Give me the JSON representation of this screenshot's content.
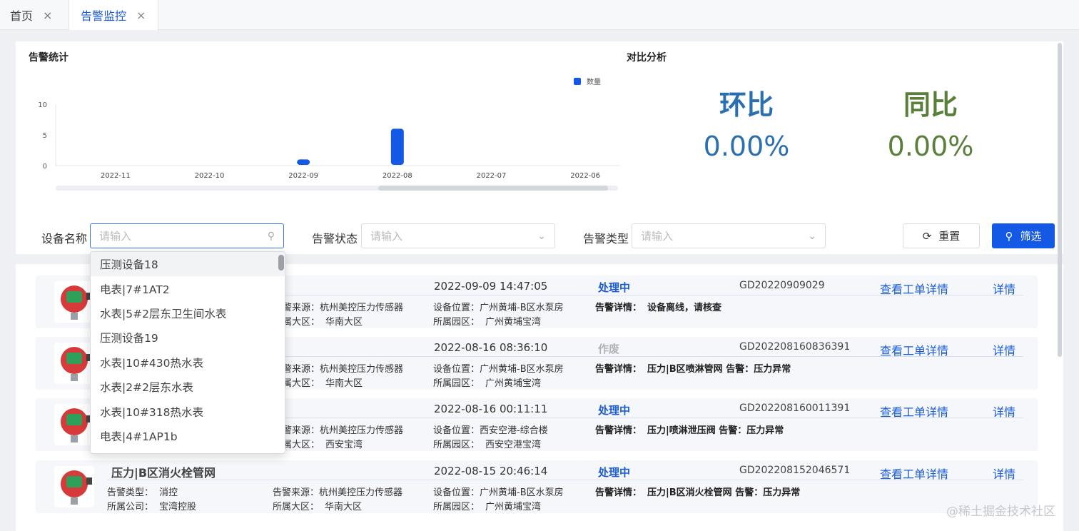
{
  "tabs": [
    {
      "label": "首页",
      "close": "×"
    },
    {
      "label": "告警监控",
      "close": "×"
    }
  ],
  "stats": {
    "title": "告警统计",
    "legend": "数量"
  },
  "chart_data": {
    "type": "bar",
    "categories": [
      "2022-11",
      "2022-10",
      "2022-09",
      "2022-08",
      "2022-07",
      "2022-06"
    ],
    "series": [
      {
        "name": "数量",
        "values": [
          0,
          0,
          1,
          6,
          0,
          0
        ]
      }
    ],
    "yticks": [
      0,
      5,
      10
    ],
    "ylim": [
      0,
      10
    ],
    "bar_color": "#1458e6",
    "grid": false
  },
  "compare": {
    "title": "对比分析",
    "mom_label": "环比",
    "mom_value": "0.00%",
    "yoy_label": "同比",
    "yoy_value": "0.00%",
    "mom_color": "#2a6fb0",
    "yoy_color": "#5a7f3a"
  },
  "filters": {
    "device_label": "设备名称",
    "device_placeholder": "请输入",
    "status_label": "告警状态",
    "status_placeholder": "请输入",
    "type_label": "告警类型",
    "type_placeholder": "请输入",
    "reset": "重置",
    "filter": "筛选"
  },
  "dropdown": {
    "options": [
      "压测设备18",
      "电表|7#1AT2",
      "水表|5#2层东卫生间水表",
      "压测设备19",
      "水表|10#430热水表",
      "水表|2#2层东水表",
      "水表|10#318热水表",
      "电表|4#1AP1b"
    ]
  },
  "labels": {
    "type": "告警类型：",
    "company": "所属公司：",
    "source": "告警来源：",
    "region": "所属大区：",
    "location": "设备位置：",
    "park": "所属园区：",
    "detail": "告警详情：",
    "view_order": "查看工单详情",
    "details": "详情"
  },
  "rows": [
    {
      "name": "",
      "source_tail": "警来源：",
      "source": "杭州美控压力传感器",
      "region_tail": "属大区：",
      "region": "华南大区",
      "time": "2022-09-09 14:47:05",
      "status": "处理中",
      "status_color": "#1a5bd6",
      "location": "广州黄埔-B区水泵房",
      "park": "广州黄埔宝湾",
      "code": "GD20220909029",
      "detail": "设备离线，请核查"
    },
    {
      "name": "",
      "source_tail": "警来源：",
      "source": "杭州美控压力传感器",
      "region_tail": "属大区：",
      "region": "华南大区",
      "time": "2022-08-16 08:36:10",
      "status": "作废",
      "status_color": "#b0b3b8",
      "location": "广州黄埔-B区水泵房",
      "park": "广州黄埔宝湾",
      "code": "GD202208160836391",
      "detail": "压力|B区喷淋管网 告警：压力异常"
    },
    {
      "name": "",
      "source_tail": "警来源：",
      "source": "杭州美控压力传感器",
      "region_tail": "属大区：",
      "region": "西安宝湾",
      "time": "2022-08-16 00:11:11",
      "status": "处理中",
      "status_color": "#1a5bd6",
      "location": "西安空港-综合楼",
      "park": "西安空港宝湾",
      "code": "GD202208160011391",
      "detail": "压力|喷淋泄压阀 告警：压力异常"
    },
    {
      "name": "压力|B区消火栓管网",
      "type": "消控",
      "company": "宝湾控股",
      "source_tail": "告警来源：",
      "source": "杭州美控压力传感器",
      "region_tail": "所属大区：",
      "region": "华南大区",
      "time": "2022-08-15 20:46:14",
      "status": "处理中",
      "status_color": "#1a5bd6",
      "location": "广州黄埔-B区水泵房",
      "park": "广州黄埔宝湾",
      "code": "GD202208152046571",
      "detail": "压力|B区消火栓管网 告警：压力异常"
    }
  ],
  "watermark": "@稀土掘金技术社区"
}
